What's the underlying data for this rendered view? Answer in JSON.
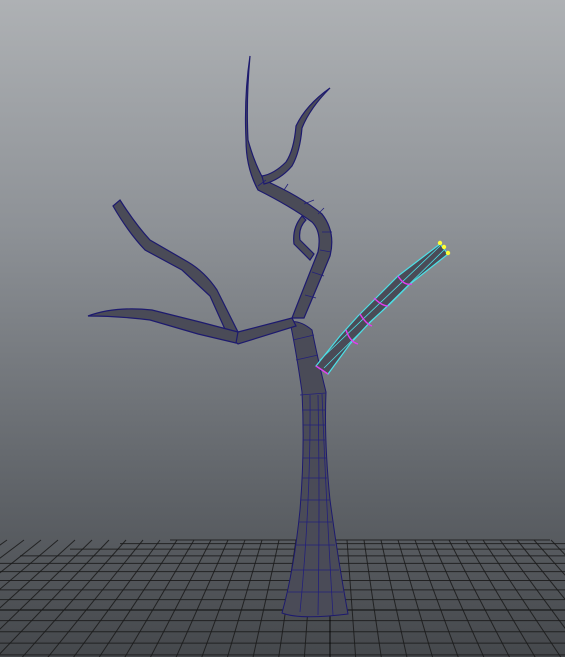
{
  "viewport": {
    "background_top": "#aeb1b4",
    "background_bottom": "#45484c"
  },
  "scene": {
    "grid_color": "#1a1a1a",
    "grid_axis_color": "#000000",
    "mesh_fill": "#4a4b57",
    "mesh_wire": "#1d1a6e",
    "mesh_fill_light": "#5a5b68",
    "selection_wire": "#4de0e6",
    "selected_edge_color": "#e23df0",
    "selected_vertex_color": "#ffff33"
  },
  "objects": [
    {
      "name": "tree-trunk",
      "kind": "polygon-mesh"
    },
    {
      "name": "branch-left-upper",
      "kind": "polygon-mesh"
    },
    {
      "name": "branch-left-lower",
      "kind": "polygon-mesh"
    },
    {
      "name": "branch-top",
      "kind": "polygon-mesh"
    },
    {
      "name": "branch-selected",
      "kind": "polygon-mesh",
      "selected": true
    }
  ]
}
